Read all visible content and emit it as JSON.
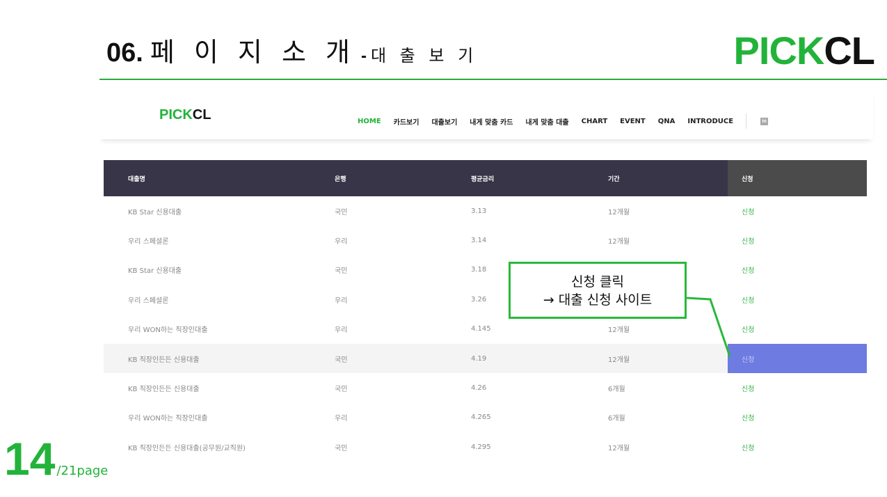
{
  "slide": {
    "number": "06.",
    "title": "페 이 지  소 개",
    "dash": "-",
    "subtitle": "대 출 보 기",
    "brand_green": "PICK",
    "brand_dark": "CL",
    "page_current": "14",
    "page_total": "/21page"
  },
  "site": {
    "logo_green": "PICK",
    "logo_dark": "CL",
    "menu": [
      "HOME",
      "카드보기",
      "대출보기",
      "내게 맞춤 카드",
      "내게 맞춤 대출",
      "CHART",
      "EVENT",
      "QNA",
      "INTRODUCE"
    ],
    "active_menu": "HOME",
    "social_icon": "linkedin-icon",
    "social_label": "in",
    "table": {
      "headers": [
        "대출명",
        "은행",
        "평균금리",
        "기간",
        "신청"
      ],
      "rows": [
        [
          "KB Star 신용대출",
          "국민",
          "3.13",
          "12개월",
          "신청"
        ],
        [
          "우리 스페셜론",
          "우리",
          "3.14",
          "12개월",
          "신청"
        ],
        [
          "KB Star 신용대출",
          "국민",
          "3.18",
          "",
          "신청"
        ],
        [
          "우리 스페셜론",
          "우리",
          "3.26",
          "",
          "신청"
        ],
        [
          "우리 WON하는 직장인대출",
          "우리",
          "4.145",
          "12개월",
          "신청"
        ],
        [
          "KB 직장인든든 신용대출",
          "국민",
          "4.19",
          "12개월",
          "신청"
        ],
        [
          "KB 직장인든든 신용대출",
          "국민",
          "4.26",
          "6개월",
          "신청"
        ],
        [
          "우리 WON하는 직장인대출",
          "우리",
          "4.265",
          "6개월",
          "신청"
        ],
        [
          "KB 직장인든든 신용대출(공무원/교직원)",
          "국민",
          "4.295",
          "12개월",
          "신청"
        ]
      ],
      "highlighted_row": 5
    }
  },
  "callout": {
    "line1": "신청 클릭",
    "line2": "→ 대출 신청 사이트"
  },
  "colors": {
    "accent_green": "#22b33a",
    "table_header": "#383548",
    "highlight": "#6e7be0"
  }
}
